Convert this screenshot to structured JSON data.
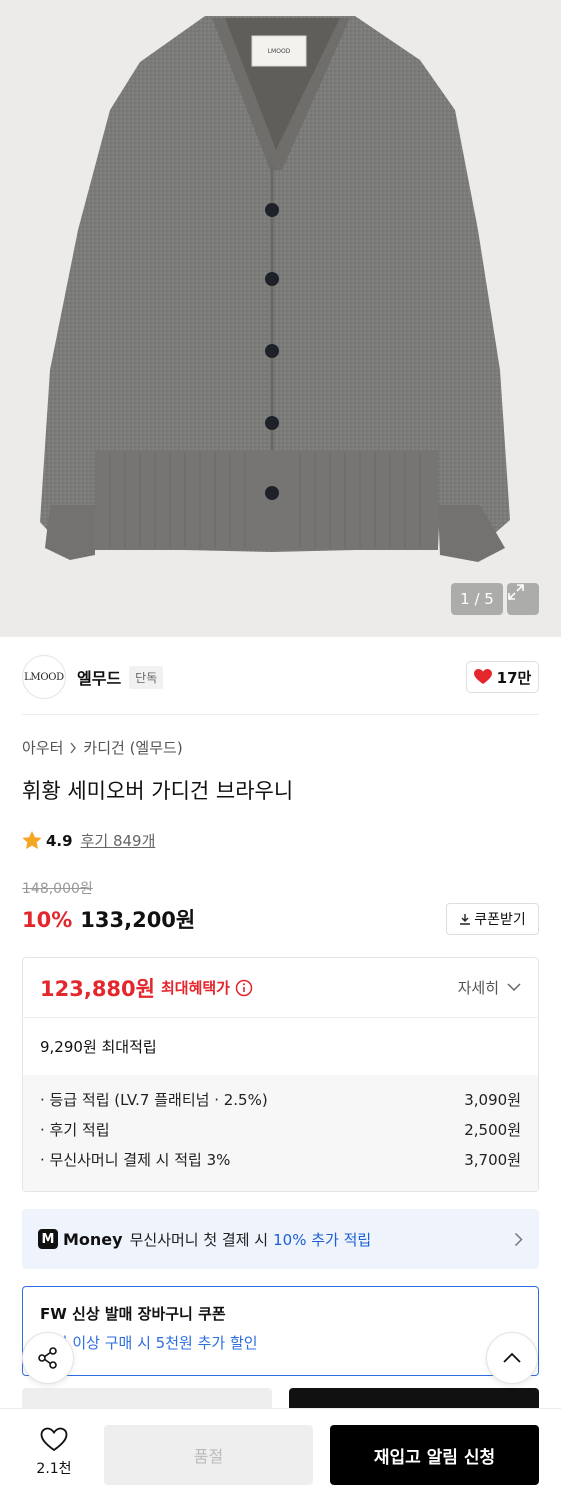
{
  "hero": {
    "counter": "1 / 5",
    "label_brand": "LMOOD"
  },
  "brand": {
    "logo_text": "LMOOD",
    "name": "엘무드",
    "tag": "단독",
    "likes": "17만"
  },
  "breadcrumb": {
    "items": [
      "아우터",
      "카디건 (엘무드)"
    ]
  },
  "product": {
    "title": "휘황 세미오버 가디건 브라우니",
    "rating": "4.9",
    "reviews": "후기 849개",
    "original_price": "148,000원",
    "discount": "10%",
    "sale_price": "133,200원",
    "coupon_button": "쿠폰받기"
  },
  "benefit": {
    "max_price": "123,880원",
    "max_label": "최대혜택가",
    "detail_label": "자세히",
    "points_total": "9,290원 최대적립",
    "points": [
      {
        "label": "· 등급 적립 (LV.7 플래티넘 · 2.5%)",
        "value": "3,090원"
      },
      {
        "label": "· 후기 적립",
        "value": "2,500원"
      },
      {
        "label": "· 무신사머니 결제 시 적립 3%",
        "value": "3,700원"
      }
    ]
  },
  "money_banner": {
    "badge": "M",
    "brand": "Money",
    "text": "무신사머니 첫 결제 시",
    "highlight": "10% 추가 적립"
  },
  "fw_coupon": {
    "title": "FW 신상 발매 장바구니 쿠폰",
    "subtitle": "만원 이상 구매 시 5천원 추가 할인"
  },
  "bottom_bar": {
    "wish_count": "2.1천",
    "soldout_label": "품절",
    "restock_label": "재입고 알림 신청"
  },
  "colors": {
    "accent_red": "#e4262d",
    "accent_blue": "#1d5fd6",
    "primary_black": "#000000"
  }
}
